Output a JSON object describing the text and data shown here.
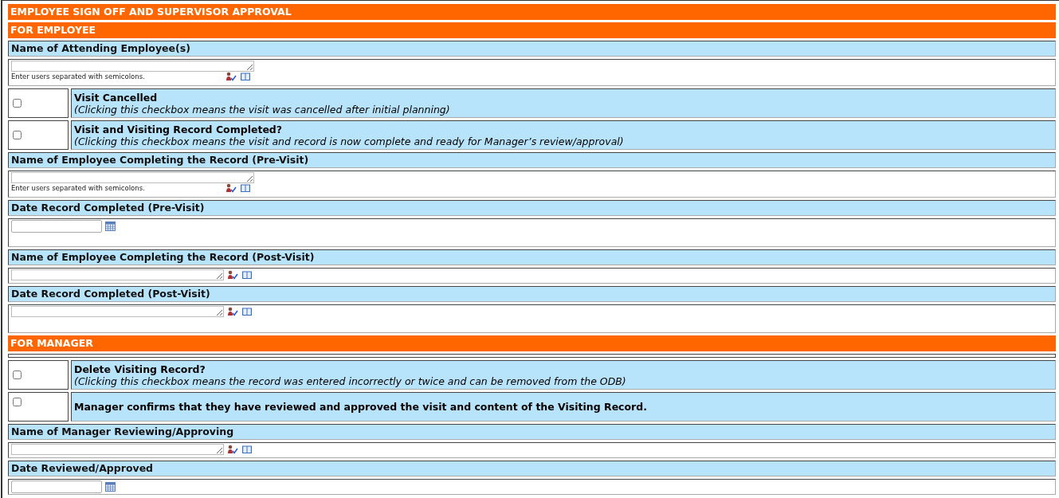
{
  "rows": [
    {
      "kind": "banner",
      "text": "EMPLOYEE SIGN OFF AND SUPERVISOR APPROVAL"
    },
    {
      "kind": "banner",
      "text": "FOR EMPLOYEE"
    },
    {
      "kind": "label",
      "text": "Name of Attending Employee(s)"
    },
    {
      "kind": "people",
      "hint": "Enter users separated with semicolons."
    },
    {
      "kind": "checkbox",
      "title": "Visit Cancelled",
      "note": "(Clicking this checkbox means the visit was cancelled after initial planning)",
      "checked": false
    },
    {
      "kind": "checkbox",
      "title": "Visit and Visiting Record Completed?",
      "note": "(Clicking this checkbox means the visit and record is now complete and ready for Manager’s review/approval)",
      "checked": false
    },
    {
      "kind": "label",
      "text": "Name of Employee Completing the Record (Pre-Visit)"
    },
    {
      "kind": "people",
      "hint": "Enter users separated with semicolons."
    },
    {
      "kind": "label",
      "text": "Date Record Completed (Pre-Visit)"
    },
    {
      "kind": "date",
      "tall": true
    },
    {
      "kind": "label",
      "text": "Name of Employee Completing the Record (Post-Visit)"
    },
    {
      "kind": "picker",
      "tall": false
    },
    {
      "kind": "label",
      "text": "Date Record Completed (Post-Visit)"
    },
    {
      "kind": "picker",
      "tall": true
    },
    {
      "kind": "banner",
      "text": "FOR MANAGER"
    },
    {
      "kind": "blank"
    },
    {
      "kind": "checkbox",
      "title": "Delete Visiting Record?",
      "note": "(Clicking this checkbox means the record was entered incorrectly or twice and can be removed from the ODB)",
      "checked": false
    },
    {
      "kind": "checkbox",
      "title": "Manager confirms that they have reviewed and approved the visit and content of the Visiting Record.",
      "checked": false
    },
    {
      "kind": "label",
      "text": "Name of Manager Reviewing/Approving"
    },
    {
      "kind": "picker",
      "tall": false
    },
    {
      "kind": "label",
      "text": "Date Reviewed/Approved"
    },
    {
      "kind": "date",
      "tall": false
    }
  ]
}
